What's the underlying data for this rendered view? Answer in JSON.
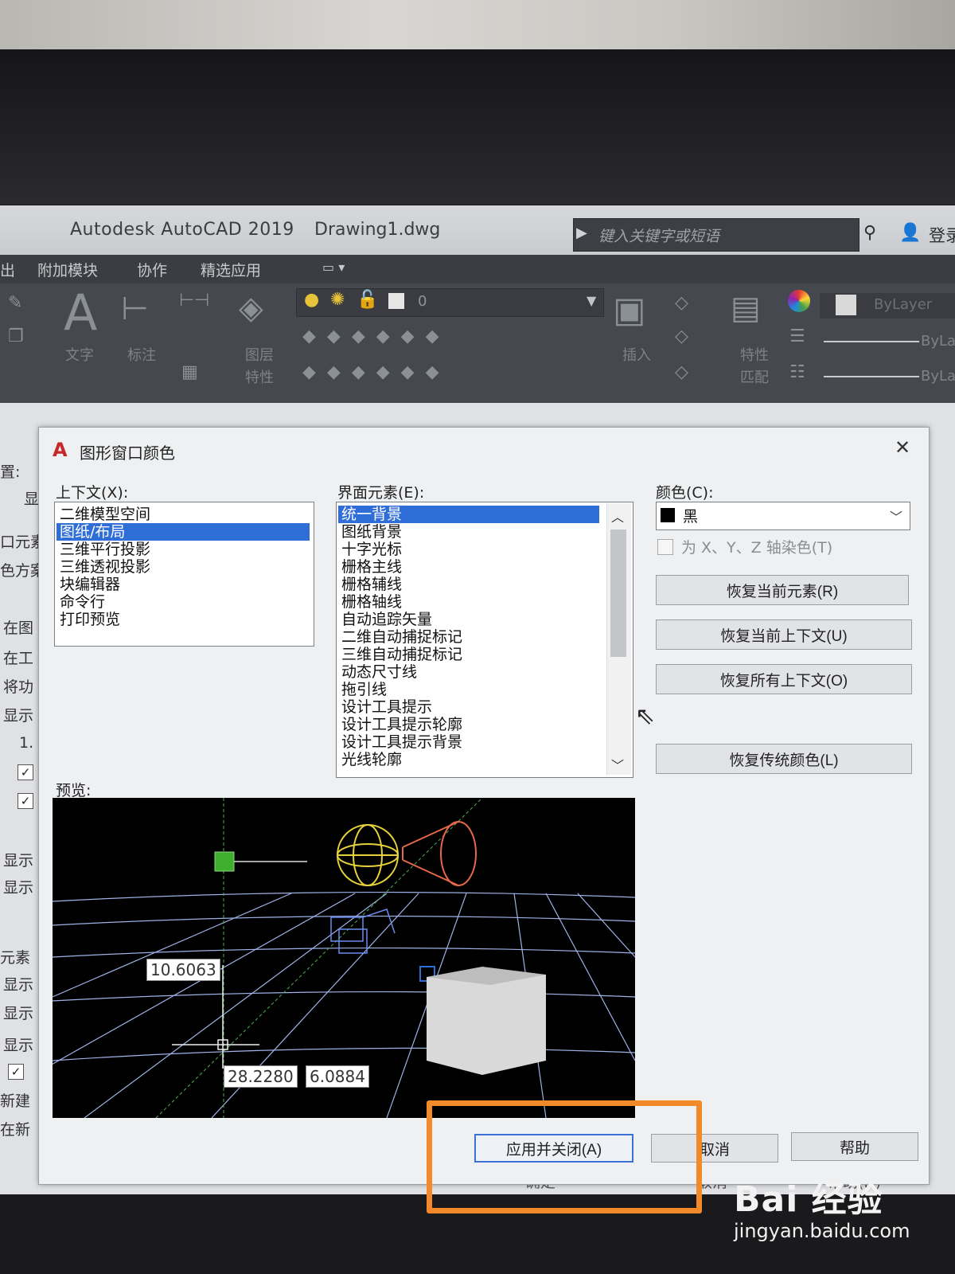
{
  "window": {
    "app_title": "Autodesk AutoCAD 2019",
    "doc_title": "Drawing1.dwg",
    "search_placeholder": "键入关键字或短语",
    "login_label": "登录"
  },
  "menu": {
    "items": [
      "出",
      "附加模块",
      "协作",
      "精选应用"
    ]
  },
  "ribbon": {
    "text_label": "文字",
    "dimension_label": "标注",
    "layer_props_label_1": "图层",
    "layer_props_label_2": "特性",
    "insert_label": "插入",
    "match_label_1": "特性",
    "match_label_2": "匹配",
    "layer_current": "0",
    "bylayer_1": "ByLayer",
    "bylayer_2": "ByLa",
    "bylayer_3": "ByLa"
  },
  "options_fragments": [
    "置:",
    "显",
    "口元素",
    "色方案",
    "在图",
    "在工",
    "将功",
    "显示",
    "1.",
    "显示",
    "显示",
    "元素",
    "显示",
    "显示",
    "显示",
    "新建",
    "在新"
  ],
  "dialog": {
    "title": "图形窗口颜色",
    "context_label": "上下文(X):",
    "contexts": [
      "二维模型空间",
      "图纸/布局",
      "三维平行投影",
      "三维透视投影",
      "块编辑器",
      "命令行",
      "打印预览"
    ],
    "selected_context": 1,
    "element_label": "界面元素(E):",
    "elements": [
      "统一背景",
      "图纸背景",
      "十字光标",
      "栅格主线",
      "栅格辅线",
      "栅格轴线",
      "自动追踪矢量",
      "二维自动捕捉标记",
      "三维自动捕捉标记",
      "动态尺寸线",
      "拖引线",
      "设计工具提示",
      "设计工具提示轮廓",
      "设计工具提示背景",
      "光线轮廓"
    ],
    "selected_element": 0,
    "color_label": "颜色(C):",
    "color_value": "黑",
    "tint_label": "为 X、Y、Z 轴染色(T)",
    "btn_restore_element": "恢复当前元素(R)",
    "btn_restore_context": "恢复当前上下文(U)",
    "btn_restore_all": "恢复所有上下文(O)",
    "btn_restore_classic": "恢复传统颜色(L)",
    "preview_label": "预览:",
    "preview_values": [
      "10.6063",
      "28.2280",
      "6.0884"
    ],
    "btn_apply": "应用并关闭(A)",
    "btn_cancel": "取消",
    "btn_help": "帮助",
    "behind_buttons": [
      "确定",
      "取消",
      "帮助(H)"
    ]
  },
  "watermark": {
    "logo": "Bai 经验",
    "url": "jingyan.baidu.com"
  },
  "colors": {
    "selection": "#2f6ed8",
    "highlight": "#f28a2a",
    "grid": "#9fb2e8",
    "sphere": "#e6d23a",
    "cone": "#e8674a",
    "ucs": "#3fae2f"
  }
}
